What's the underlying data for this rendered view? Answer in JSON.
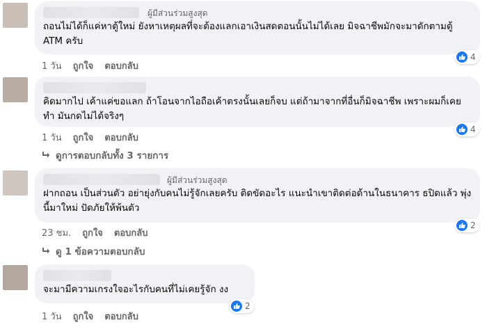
{
  "comments": [
    {
      "badge": "ผู้มีส่วนร่วมสูงสุด",
      "text": "ถอนไม่ได้ก็แค่หาตู้ใหม่ ยังหาเหตุผลที่จะต้องแลกเอาเงินสดตอนนั้นไม่ได้เลย มิจฉาชีพมักจะมาดักตามตู้ ATM ครับ",
      "time": "1 วัน",
      "like_label": "ถูกใจ",
      "reply_label": "ตอบกลับ",
      "reaction_count": "4"
    },
    {
      "badge": "",
      "text": "คิดมากไป เค้าแค่ขอแลก ถ้าโอนจากไอถือเค้าตรงนั้นเลยก็จบ แต่ถ้ามาจากที่อื่นก็มิจฉาชีพ เพราะผมก็เคยทำ มันกดไม่ได้จริงๆ",
      "time": "1 วัน",
      "like_label": "ถูกใจ",
      "reply_label": "ตอบกลับ",
      "reaction_count": "4",
      "view_replies": "ดูการตอบกลับทั้ง 3 รายการ"
    },
    {
      "badge": "ผู้มีส่วนร่วมสูงสุด",
      "text": "ฝากถอน เป็นส่วนตัว อย่ายุ่งกับคนไม่รู้จักเลยครับ ติดขัดอะไร แนะนำเขาติดต่อด้านในธนาคาร ธปิดแล้ว พุ่งนี้มาใหม่ ปัดภัยให้พ้นตัว",
      "time": "23 ชม.",
      "like_label": "ถูกใจ",
      "reply_label": "ตอบกลับ",
      "reaction_count": "2",
      "view_replies": "ดู 1 ข้อความตอบกลับ"
    },
    {
      "badge": "",
      "text": "จะมามีความเกรงใจอะไรกับคนที่ไม่เคยรู้จัก งง",
      "time": "1 วัน",
      "like_label": "ถูกใจ",
      "reply_label": "ตอบกลับ",
      "reaction_count": "2"
    }
  ],
  "colors": {
    "bubble": "#f0f2f5",
    "like_blue": "#1877f2",
    "meta_gray": "#65676b"
  },
  "icons": {
    "like": "thumbs-up-icon",
    "reply_arrow": "reply-arrow-icon"
  }
}
